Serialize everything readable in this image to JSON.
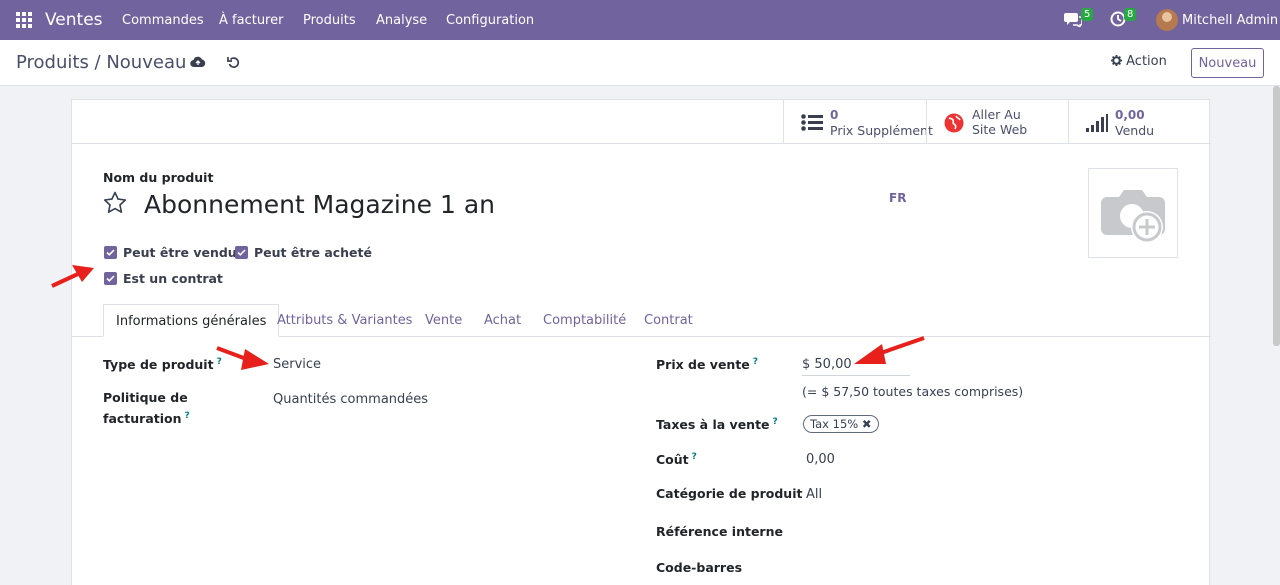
{
  "navbar": {
    "app_name": "Ventes",
    "menu": [
      "Commandes",
      "À facturer",
      "Produits",
      "Analyse",
      "Configuration"
    ],
    "messages_count": "5",
    "activities_count": "8",
    "user": "Mitchell Admin"
  },
  "control_panel": {
    "breadcrumb": "Produits / Nouveau",
    "action_label": "Action",
    "new_label": "Nouveau"
  },
  "stats": [
    {
      "value": "0",
      "label": "Prix Supplément",
      "icon": "list-icon"
    },
    {
      "value": "",
      "label": "Aller Au",
      "label2": "Site Web",
      "icon": "globe-icon"
    },
    {
      "value": "0,00",
      "label": "Vendu",
      "icon": "signal-bars-icon"
    }
  ],
  "product": {
    "name_label": "Nom du produit",
    "name": "Abonnement Magazine 1 an",
    "lang": "FR",
    "checkboxes": {
      "can_be_sold": "Peut être vendu",
      "can_be_purchased": "Peut être acheté",
      "is_contract": "Est un contrat"
    }
  },
  "tabs": [
    "Informations générales",
    "Attributs & Variantes",
    "Vente",
    "Achat",
    "Comptabilité",
    "Contrat"
  ],
  "general": {
    "product_type_label": "Type de produit",
    "product_type": "Service",
    "invoice_policy_label_1": "Politique de",
    "invoice_policy_label_2": "facturation",
    "invoice_policy": "Quantités commandées",
    "sale_price_label": "Prix de vente",
    "sale_price": "$ 50,00",
    "sale_price_incl": "(= $ 57,50 toutes taxes comprises)",
    "sale_taxes_label": "Taxes à la vente",
    "sale_tax": "Tax 15%",
    "cost_label": "Coût",
    "cost": "0,00",
    "category_label": "Catégorie de produit",
    "category": "All",
    "internal_ref_label": "Référence interne",
    "barcode_label": "Code-barres",
    "help_mark": "?"
  },
  "colors": {
    "navbar": "#71639e",
    "accent": "#71639e",
    "help": "#017e84",
    "badge": "#28a745",
    "annotation_arrow": "#e8201b"
  }
}
